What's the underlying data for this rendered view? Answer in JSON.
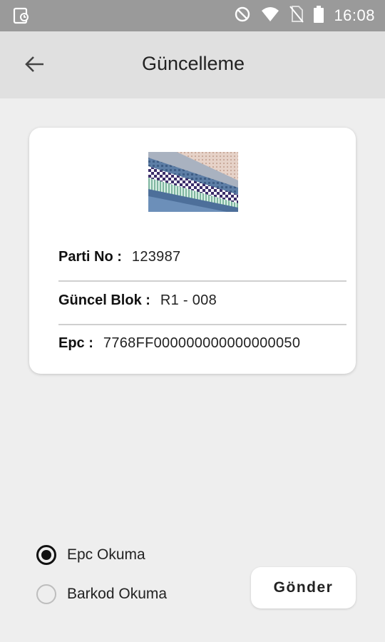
{
  "status_bar": {
    "time": "16:08",
    "icons": [
      "app-notification-icon",
      "do-not-disturb-icon",
      "wifi-icon",
      "no-sim-icon",
      "battery-icon"
    ]
  },
  "app_bar": {
    "title": "Güncelleme",
    "back_icon": "arrow-left-icon"
  },
  "card": {
    "image": "fabric-rolls-image",
    "fields": [
      {
        "label": "Parti No :",
        "value": "123987"
      },
      {
        "label": "Güncel Blok :",
        "value": "R1 - 008"
      },
      {
        "label": "Epc :",
        "value": "7768FF000000000000000050"
      }
    ]
  },
  "read_mode": {
    "options": [
      {
        "label": "Epc Okuma",
        "selected": true
      },
      {
        "label": "Barkod Okuma",
        "selected": false
      }
    ]
  },
  "actions": {
    "send_label": "Gönder"
  },
  "colors": {
    "status_bar": "#9a9a9a",
    "app_bar": "#e0e0e0",
    "background": "#eeeeee",
    "card": "#ffffff"
  }
}
